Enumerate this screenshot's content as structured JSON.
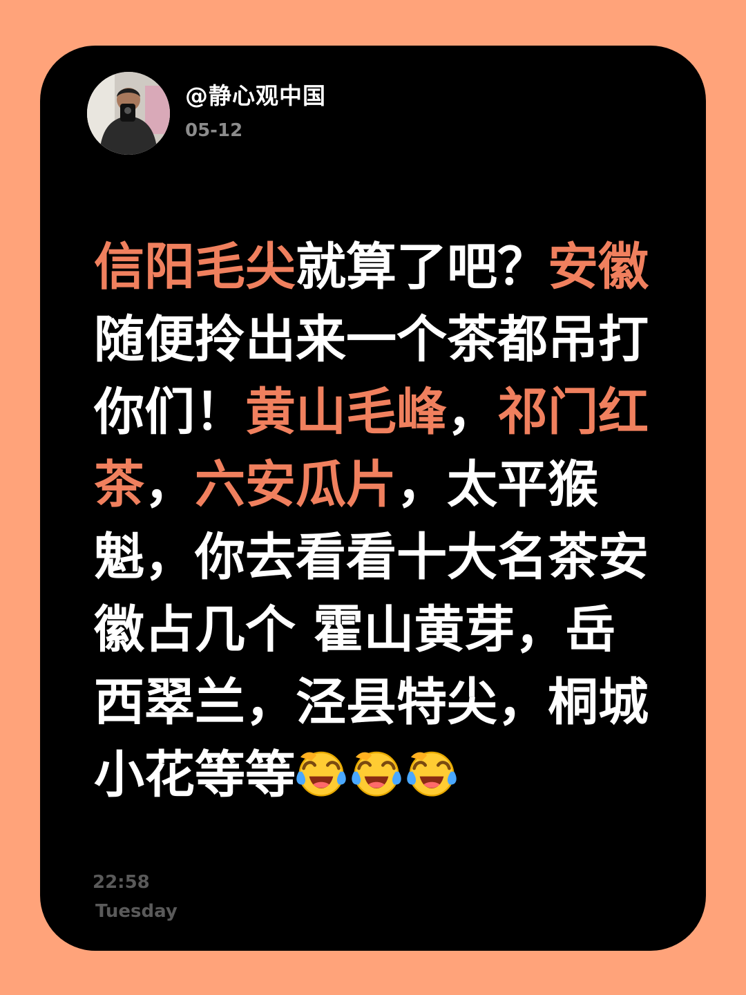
{
  "post": {
    "username": "@静心观中国",
    "date": "05-12",
    "body_segments": [
      {
        "text": "信阳毛尖",
        "highlight": true
      },
      {
        "text": "就算了吧？",
        "highlight": false
      },
      {
        "text": "安徽",
        "highlight": true
      },
      {
        "text": "随便拎出来一个茶都吊打你们！",
        "highlight": false
      },
      {
        "text": "黄山毛峰",
        "highlight": true
      },
      {
        "text": "，",
        "highlight": false
      },
      {
        "text": "祁门红茶",
        "highlight": true
      },
      {
        "text": "，",
        "highlight": false
      },
      {
        "text": "六安瓜片",
        "highlight": true
      },
      {
        "text": "，太平猴魁，你去看看十大名茶安徽占几个 霍山黄芽，岳西翠兰，泾县特尖，桐城小花等等",
        "highlight": false
      }
    ],
    "emojis": [
      "laughing-crying-emoji",
      "laughing-crying-emoji",
      "laughing-crying-emoji"
    ]
  },
  "footer": {
    "time": "22:58",
    "weekday": "Tuesday"
  },
  "colors": {
    "background": "#FFA37A",
    "card": "#000000",
    "highlight": "#F0805E",
    "body_text": "#FFFFFF",
    "meta_text": "#8C8C8C"
  }
}
